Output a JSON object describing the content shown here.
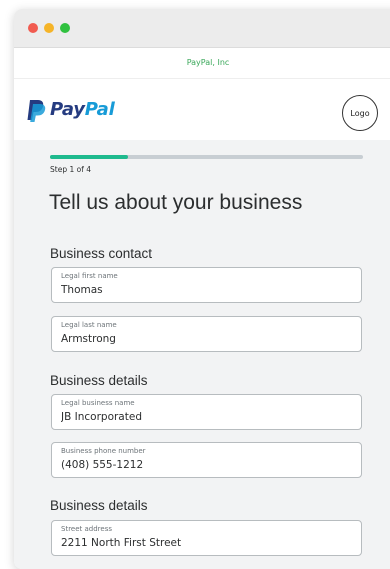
{
  "window": {
    "url_label": "PayPal, Inc"
  },
  "header": {
    "brand_pay": "Pay",
    "brand_pal": "Pal",
    "logo_placeholder": "Logo"
  },
  "progress": {
    "step_label": "Step 1 of 4",
    "fraction": 0.25
  },
  "form": {
    "title": "Tell us about your business",
    "sections": [
      {
        "title": "Business contact",
        "fields": [
          {
            "label": "Legal first name",
            "value": "Thomas"
          },
          {
            "label": "Legal last name",
            "value": "Armstrong"
          }
        ]
      },
      {
        "title": "Business details",
        "fields": [
          {
            "label": "Legal business name",
            "value": "JB Incorporated"
          },
          {
            "label": "Business phone number",
            "value": "(408) 555-1212"
          }
        ]
      },
      {
        "title": "Business details",
        "fields": [
          {
            "label": "Street address",
            "value": "2211 North First Street"
          }
        ]
      }
    ]
  },
  "colors": {
    "progress_fill": "#1fba8e",
    "progress_track": "#c8ced3",
    "paypal_dark_blue": "#253b80",
    "paypal_light_blue": "#179bd7",
    "url_green": "#3aa85a"
  }
}
